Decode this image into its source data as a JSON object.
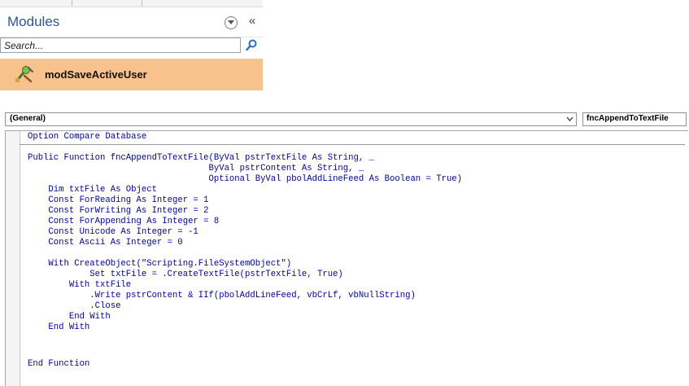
{
  "nav_pane": {
    "title": "Modules",
    "dropdown_icon": "chevron-down-circle-icon",
    "collapse_label": "«",
    "search": {
      "value": "",
      "placeholder": "Search..."
    },
    "search_icon": "magnifier-icon",
    "items": [
      {
        "label": "modSaveActiveUser",
        "icon": "module-icon",
        "selected": true
      }
    ],
    "colors": {
      "title": "#2b579a",
      "selected_item": "#f8c28c"
    }
  },
  "code_window": {
    "object_combo": "(General)",
    "procedure_combo": "fncAppendToTextFile",
    "code_color": "#0000b0",
    "lines": [
      "Option Compare Database",
      "",
      "Public Function fncAppendToTextFile(ByVal pstrTextFile As String, _",
      "                                   ByVal pstrContent As String, _",
      "                                   Optional ByVal pbolAddLineFeed As Boolean = True)",
      "    Dim txtFile As Object",
      "    Const ForReading As Integer = 1",
      "    Const ForWriting As Integer = 2",
      "    Const ForAppending As Integer = 8",
      "    Const Unicode As Integer = -1",
      "    Const Ascii As Integer = 0",
      "",
      "    With CreateObject(\"Scripting.FileSystemObject\")",
      "            Set txtFile = .CreateTextFile(pstrTextFile, True)",
      "        With txtFile",
      "            .Write pstrContent & IIf(pbolAddLineFeed, vbCrLf, vbNullString)",
      "            .Close",
      "        End With",
      "    End With",
      "",
      "End Function"
    ]
  }
}
